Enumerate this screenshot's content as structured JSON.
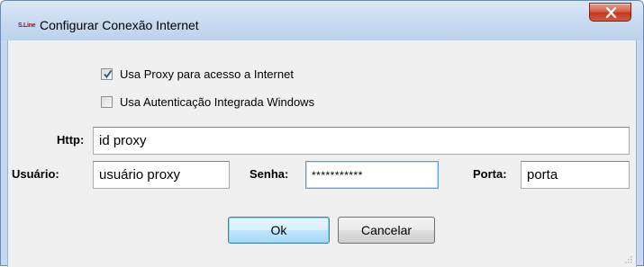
{
  "window": {
    "title": "Configurar Conexão Internet",
    "icon_text": "S.Line"
  },
  "options": {
    "use_proxy": {
      "label": "Usa Proxy para acesso a Internet",
      "checked": true
    },
    "integrated_auth": {
      "label": "Usa Autenticação Integrada Windows",
      "checked": false
    }
  },
  "fields": {
    "http": {
      "label": "Http:",
      "value": "id proxy"
    },
    "user": {
      "label": "Usuário:",
      "value": "usuário proxy"
    },
    "password": {
      "label": "Senha:",
      "value": "***********"
    },
    "port": {
      "label": "Porta:",
      "value": "porta"
    }
  },
  "buttons": {
    "ok": "Ok",
    "cancel": "Cancelar"
  },
  "icons": {
    "close": "close-icon",
    "check": "checkmark-icon",
    "app": "app-icon",
    "grip": "resize-grip-icon"
  },
  "colors": {
    "title_bar": "#c8daf0",
    "close_button": "#c4381f",
    "client_bg": "#f0f0f0",
    "focus_border": "#569de5"
  }
}
